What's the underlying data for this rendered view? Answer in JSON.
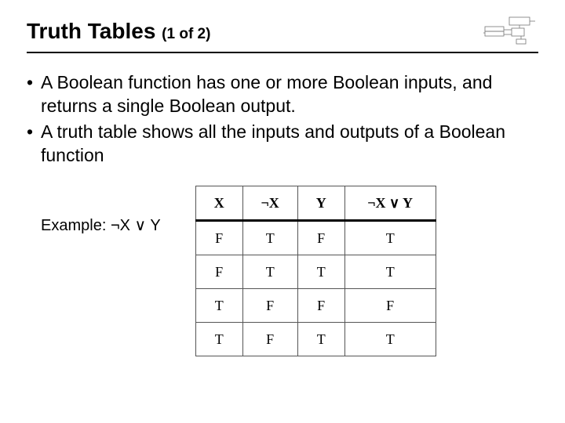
{
  "title": "Truth Tables",
  "title_sub": "(1 of 2)",
  "bullets": {
    "b1": "A Boolean function has one or more Boolean inputs, and returns a single Boolean output.",
    "b2": "A truth table shows all the inputs and outputs of a Boolean function"
  },
  "example": {
    "prefix": "Example: ",
    "expr": "¬X ∨ Y"
  },
  "table": {
    "h1": "X",
    "h2": "¬X",
    "h3": "Y",
    "h4": "¬X ∨ Y",
    "rows": [
      {
        "x": "F",
        "nx": "T",
        "y": "F",
        "r": "T"
      },
      {
        "x": "F",
        "nx": "T",
        "y": "T",
        "r": "T"
      },
      {
        "x": "T",
        "nx": "F",
        "y": "F",
        "r": "F"
      },
      {
        "x": "T",
        "nx": "F",
        "y": "T",
        "r": "T"
      }
    ]
  },
  "chart_data": {
    "type": "table",
    "title": "Truth table for ¬X ∨ Y",
    "columns": [
      "X",
      "¬X",
      "Y",
      "¬X ∨ Y"
    ],
    "rows": [
      [
        "F",
        "T",
        "F",
        "T"
      ],
      [
        "F",
        "T",
        "T",
        "T"
      ],
      [
        "T",
        "F",
        "F",
        "F"
      ],
      [
        "T",
        "F",
        "T",
        "T"
      ]
    ]
  }
}
